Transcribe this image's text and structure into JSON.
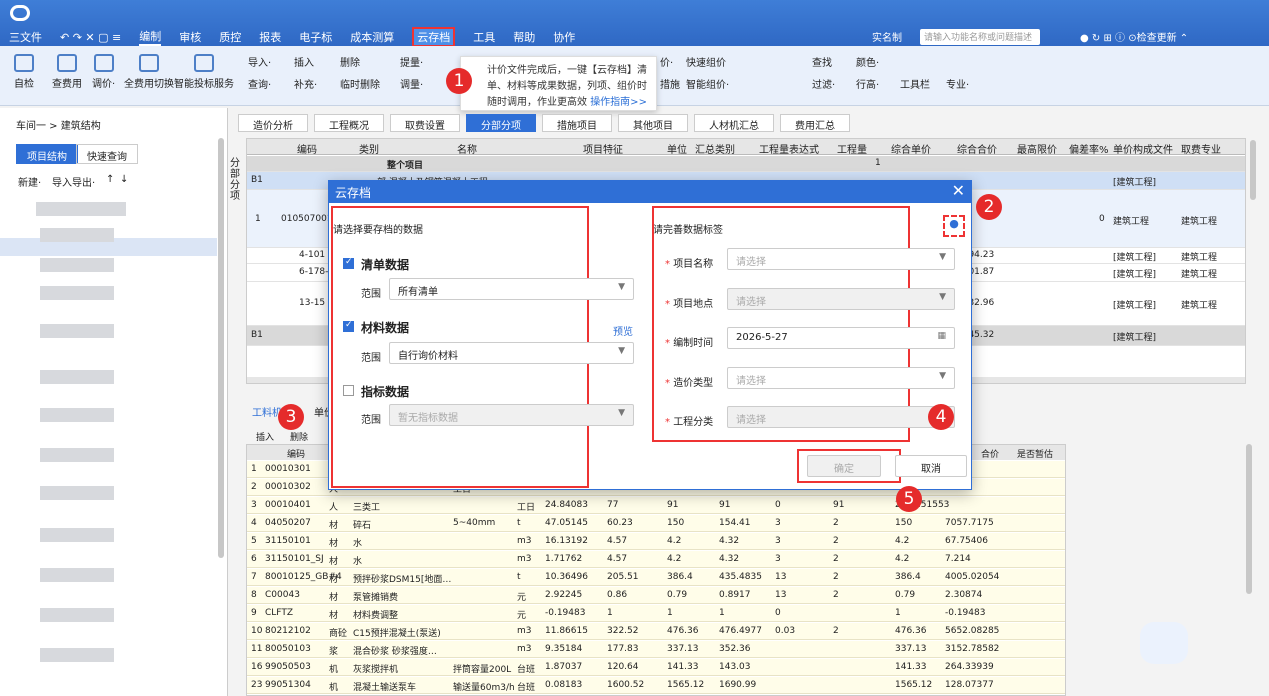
{
  "titlebar": {
    "menus": [
      "三文件",
      "编制",
      "审核",
      "质控",
      "报表",
      "电子标",
      "成本测算",
      "云存档",
      "工具",
      "帮助",
      "协作"
    ],
    "realname": "实名制",
    "search_placeholder": "请输入功能名称或问题描述",
    "update": "检查更新"
  },
  "ribbon": {
    "big": [
      "自检",
      "查费用",
      "调价·",
      "全费用切换",
      "智能投标服务"
    ],
    "small": [
      "导入·",
      "插入",
      "删除",
      "提量·",
      "查询·",
      "补充·",
      "临时删除",
      "调量·",
      "价·",
      "快速组价",
      "措施",
      "智能组价·",
      "查找",
      "颜色·",
      "过滤·",
      "行高·",
      "工具栏",
      "专业·"
    ]
  },
  "tooltip": {
    "text": "计价文件完成后，一键【云存档】清单、材料等成果数据，列项、组价时随时调用，作业更高效",
    "link": "操作指南>>"
  },
  "badges": [
    "1",
    "2",
    "3",
    "4",
    "5"
  ],
  "left": {
    "breadcrumb": "车间一 > 建筑结构",
    "tabs": [
      "项目结构",
      "快速查询"
    ],
    "toolbar": [
      "新建·",
      "导入导出·",
      "↑",
      "↓"
    ]
  },
  "center_tabs": [
    "造价分析",
    "工程概况",
    "取费设置",
    "分部分项",
    "措施项目",
    "其他项目",
    "人材机汇总",
    "费用汇总"
  ],
  "grid": {
    "headers": [
      "编码",
      "类别",
      "名称",
      "项目特征",
      "单位",
      "汇总类别",
      "工程量表达式",
      "工程量",
      "综合单价",
      "综合合价",
      "最高限价",
      "偏差率%",
      "单价构成文件",
      "取费专业"
    ],
    "rows": [
      {
        "code": "",
        "name": "整个项目",
        "qty": "1"
      },
      {
        "code": "B1",
        "name": "部  混凝土及钢筋混凝土工程",
        "fee": "[建筑工程]"
      },
      {
        "code": "1",
        "sub": "010507001",
        "tail0": "0",
        "fee": "建筑工程",
        "prof": "建筑工程"
      },
      {
        "code": "4-101",
        "total": "3294.23",
        "fee": "[建筑工程]",
        "prof": "建筑工程"
      },
      {
        "code": "6-178-",
        "total": "6501.87",
        "fee": "[建筑工程]",
        "prof": "建筑工程"
      },
      {
        "code": "13-15",
        "total": "5932.96",
        "fee": "[建筑工程]",
        "prof": "建筑工程"
      },
      {
        "code": "B1",
        "total": "1545.32",
        "fee": "[建筑工程]"
      }
    ]
  },
  "sidebar_tabs": [
    "分",
    "部",
    "分",
    "项",
    "部"
  ],
  "bottom": {
    "tabs": [
      "工料机",
      "单价"
    ],
    "tools": [
      "插入",
      "删除"
    ],
    "headers": [
      "编码",
      "",
      "",
      "",
      "",
      "",
      "",
      "",
      "",
      "",
      "",
      "合价",
      "是否暂估"
    ],
    "rows": [
      [
        "1",
        "00010301",
        "",
        "",
        "",
        "",
        "",
        "",
        "",
        "",
        "",
        "49.8878"
      ],
      [
        "2",
        "00010302",
        "人",
        "",
        "工日",
        "24.84083",
        "62",
        "",
        "",
        "",
        "",
        "",
        "1901.54932"
      ],
      [
        "3",
        "00010401",
        "人",
        "三类工",
        "",
        "工日",
        "24.84083",
        "77",
        "91",
        "91",
        "0",
        "91",
        "2260.51553"
      ],
      [
        "4",
        "04050207",
        "材",
        "碎石",
        "5~40mm",
        "t",
        "47.05145",
        "60.23",
        "150",
        "154.41",
        "3",
        "2",
        "150",
        "7057.7175"
      ],
      [
        "5",
        "31150101",
        "材",
        "水",
        "",
        "m3",
        "16.13192",
        "4.57",
        "4.2",
        "4.32",
        "3",
        "2",
        "4.2",
        "67.75406"
      ],
      [
        "6",
        "31150101_SJ",
        "材",
        "水",
        "",
        "m3",
        "1.71762",
        "4.57",
        "4.2",
        "4.32",
        "3",
        "2",
        "4.2",
        "7.214"
      ],
      [
        "7",
        "80010125_GB#4",
        "材",
        "预拌砂浆DSM15[地面…",
        "",
        "t",
        "10.36496",
        "205.51",
        "386.4",
        "435.4835",
        "13",
        "2",
        "386.4",
        "4005.02054"
      ],
      [
        "8",
        "C00043",
        "材",
        "泵管摊销费",
        "",
        "元",
        "2.92245",
        "0.86",
        "0.79",
        "0.8917",
        "13",
        "2",
        "0.79",
        "2.30874"
      ],
      [
        "9",
        "CLFTZ",
        "材",
        "材料费调整",
        "",
        "元",
        "-0.19483",
        "1",
        "1",
        "1",
        "0",
        "",
        "1",
        "-0.19483"
      ],
      [
        "10",
        "80212102",
        "商砼",
        "C15预拌混凝土(泵送)",
        "",
        "m3",
        "11.86615",
        "322.52",
        "476.36",
        "476.4977",
        "0.03",
        "2",
        "476.36",
        "5652.08285"
      ],
      [
        "11",
        "80050103",
        "浆",
        "混合砂浆 砂浆强度…",
        "",
        "m3",
        "9.35184",
        "177.83",
        "337.13",
        "352.36",
        "",
        "",
        "337.13",
        "3152.78582"
      ],
      [
        "16",
        "99050503",
        "机",
        "灰浆搅拌机",
        "拌筒容量200L",
        "台班",
        "1.87037",
        "120.64",
        "141.33",
        "143.03",
        "",
        "",
        "141.33",
        "264.33939"
      ],
      [
        "23",
        "99051304",
        "机",
        "混凝土输送泵车",
        "输送量60m3/h",
        "台班",
        "0.08183",
        "1600.52",
        "1565.12",
        "1690.99",
        "",
        "",
        "1565.12",
        "128.07377"
      ]
    ]
  },
  "dialog": {
    "title": "云存档",
    "left_title": "请选择要存档的数据",
    "right_title": "请完善数据标签",
    "sections": [
      {
        "label": "清单数据",
        "checked": true,
        "range_label": "范围",
        "range_value": "所有清单",
        "disabled": false
      },
      {
        "label": "材料数据",
        "checked": true,
        "range_label": "范围",
        "range_value": "自行询价材料",
        "disabled": false,
        "preview": "预览"
      },
      {
        "label": "指标数据",
        "checked": false,
        "range_label": "范围",
        "range_value": "暂无指标数据",
        "disabled": true
      }
    ],
    "fields": [
      {
        "label": "项目名称",
        "value": "请选择",
        "disabled": false
      },
      {
        "label": "项目地点",
        "value": "请选择",
        "disabled": true
      },
      {
        "label": "编制时间",
        "value": "2026-5-27",
        "disabled": false
      },
      {
        "label": "造价类型",
        "value": "请选择",
        "disabled": false
      },
      {
        "label": "工程分类",
        "value": "请选择",
        "disabled": true
      }
    ],
    "confirm": "确定",
    "cancel": "取消"
  },
  "colors": {
    "accent": "#2f6fd6",
    "highlight": "#e33",
    "titlebar": "#3f7ed7"
  }
}
